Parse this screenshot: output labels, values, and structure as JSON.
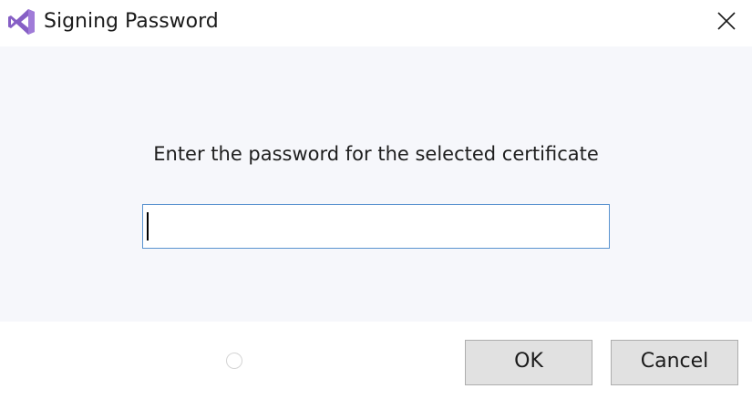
{
  "window": {
    "title": "Signing Password"
  },
  "dialog": {
    "prompt": "Enter the password for the selected certificate",
    "password_value": ""
  },
  "buttons": {
    "ok_label": "OK",
    "cancel_label": "Cancel"
  },
  "icons": {
    "app": "visual-studio-icon",
    "close": "close-icon",
    "busy": "spinner-icon"
  },
  "colors": {
    "accent": "#5a93d0",
    "content_bg": "#f6f7fb",
    "button_bg": "#e1e1e1",
    "logo_purple": "#865fc5"
  }
}
